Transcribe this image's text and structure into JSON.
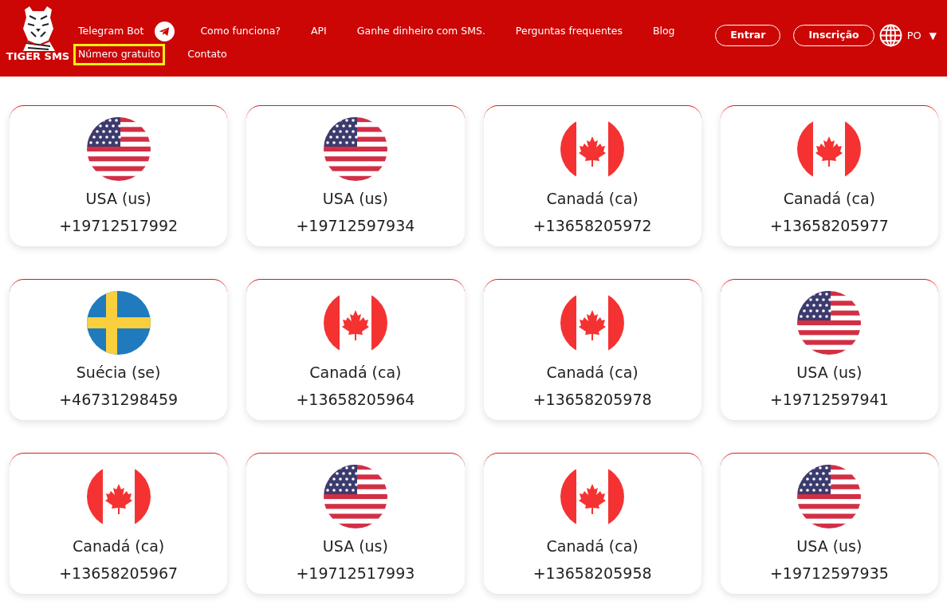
{
  "header": {
    "logo_text": "TIGER SMS",
    "nav_row_1": [
      {
        "label": "Telegram Bot",
        "kind": "telegram",
        "highlighted": false
      },
      {
        "label": "Como funciona?",
        "kind": "link",
        "highlighted": false
      },
      {
        "label": "API",
        "kind": "link",
        "highlighted": false
      },
      {
        "label": "Ganhe dinheiro com SMS.",
        "kind": "link",
        "highlighted": false
      },
      {
        "label": "Perguntas frequentes",
        "kind": "link",
        "highlighted": false
      },
      {
        "label": "Blog",
        "kind": "link",
        "highlighted": false
      }
    ],
    "nav_row_2": [
      {
        "label": "Número gratuito",
        "kind": "link",
        "highlighted": true
      },
      {
        "label": "Contato",
        "kind": "link",
        "highlighted": false
      }
    ],
    "buttons": [
      "Entrar",
      "Inscrição"
    ],
    "language": {
      "code": "PO",
      "caret": "▼"
    }
  },
  "numbers": [
    {
      "kind": "usflag",
      "country": "USA (us)",
      "phone": "+19712517992"
    },
    {
      "kind": "usflag",
      "country": "USA (us)",
      "phone": "+19712597934"
    },
    {
      "kind": "caflag",
      "country": "Canadá (ca)",
      "phone": "+13658205972"
    },
    {
      "kind": "caflag",
      "country": "Canadá (ca)",
      "phone": "+13658205977"
    },
    {
      "kind": "seflag",
      "country": "Suécia (se)",
      "phone": "+46731298459"
    },
    {
      "kind": "caflag",
      "country": "Canadá (ca)",
      "phone": "+13658205964"
    },
    {
      "kind": "caflag",
      "country": "Canadá (ca)",
      "phone": "+13658205978"
    },
    {
      "kind": "usflag",
      "country": "USA (us)",
      "phone": "+19712597941"
    },
    {
      "kind": "caflag",
      "country": "Canadá (ca)",
      "phone": "+13658205967"
    },
    {
      "kind": "usflag",
      "country": "USA (us)",
      "phone": "+19712517993"
    },
    {
      "kind": "caflag",
      "country": "Canadá (ca)",
      "phone": "+13658205958"
    },
    {
      "kind": "usflag",
      "country": "USA (us)",
      "phone": "+19712597935"
    }
  ]
}
